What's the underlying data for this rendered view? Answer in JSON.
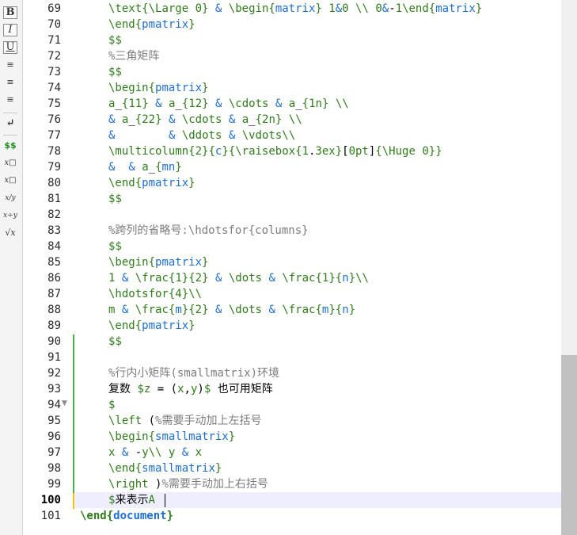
{
  "toolbar": {
    "bold": "B",
    "italic": "I",
    "underline": "U",
    "align_left": "≡",
    "align_center": "≡",
    "align_right": "≡",
    "newline": "↵",
    "math": "$$",
    "subscript": "x□",
    "superscript": "x□",
    "fraction": "x/y",
    "fraction2": "x÷y",
    "sqrt": "√x"
  },
  "editor": {
    "current_line": 100,
    "lines": [
      {
        "n": "69",
        "t": "\\text{\\Large 0} & \\begin{matrix} 1&0 \\\\ 0&-1\\end{matrix}"
      },
      {
        "n": "70",
        "t": "\\end{pmatrix}"
      },
      {
        "n": "71",
        "t": "$$"
      },
      {
        "n": "72",
        "t": "%三角矩阵"
      },
      {
        "n": "73",
        "t": "$$"
      },
      {
        "n": "74",
        "t": "\\begin{pmatrix}"
      },
      {
        "n": "75",
        "t": "a_{11} & a_{12} & \\cdots & a_{1n} \\\\"
      },
      {
        "n": "76",
        "t": "& a_{22} & \\cdots & a_{2n} \\\\"
      },
      {
        "n": "77",
        "t": "&        & \\ddots & \\vdots\\\\"
      },
      {
        "n": "78",
        "t": "\\multicolumn{2}{c}{\\raisebox{1.3ex}[0pt]{\\Huge 0}}"
      },
      {
        "n": "79",
        "t": "&  & a_{mn}"
      },
      {
        "n": "80",
        "t": "\\end{pmatrix}"
      },
      {
        "n": "81",
        "t": "$$"
      },
      {
        "n": "82",
        "t": ""
      },
      {
        "n": "83",
        "t": "%跨列的省略号:\\hdotsfor{columns}"
      },
      {
        "n": "84",
        "t": "$$"
      },
      {
        "n": "85",
        "t": "\\begin{pmatrix}"
      },
      {
        "n": "86",
        "t": "1 & \\frac{1}{2} & \\dots & \\frac{1}{n}\\\\"
      },
      {
        "n": "87",
        "t": "\\hdotsfor{4}\\\\"
      },
      {
        "n": "88",
        "t": "m & \\frac{m}{2} & \\dots & \\frac{m}{n}"
      },
      {
        "n": "89",
        "t": "\\end{pmatrix}"
      },
      {
        "n": "90",
        "t": "$$"
      },
      {
        "n": "91",
        "t": ""
      },
      {
        "n": "92",
        "t": "%行内小矩阵(smallmatrix)环境"
      },
      {
        "n": "93",
        "t": "复数 $z = (x,y)$ 也可用矩阵"
      },
      {
        "n": "94",
        "t": "$"
      },
      {
        "n": "95",
        "t": "\\left (%需要手动加上左括号"
      },
      {
        "n": "96",
        "t": "\\begin{smallmatrix}"
      },
      {
        "n": "97",
        "t": "x & -y\\\\ y & x"
      },
      {
        "n": "98",
        "t": "\\end{smallmatrix}"
      },
      {
        "n": "99",
        "t": "\\right )%需要手动加上右括号"
      },
      {
        "n": "100",
        "t": "$来表示A"
      },
      {
        "n": "101",
        "t": "\\end{document}"
      }
    ]
  }
}
